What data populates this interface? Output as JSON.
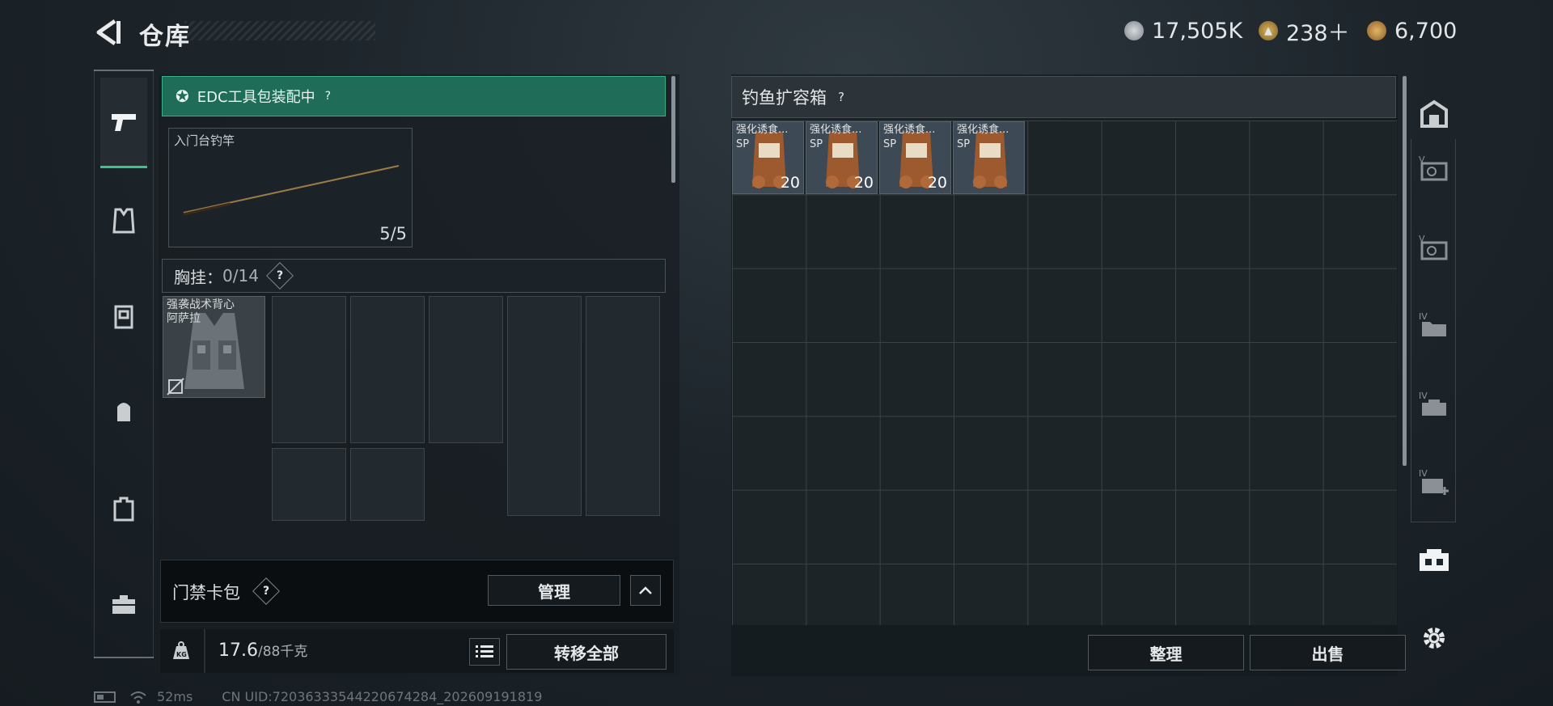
{
  "header": {
    "title": "仓库",
    "currencies": [
      {
        "icon": "silver-coin-icon",
        "value": "17,505K"
      },
      {
        "icon": "triangle-coin-icon",
        "value": "238＋"
      },
      {
        "icon": "gold-coin-icon",
        "value": "6,700"
      }
    ]
  },
  "left_tabs": [
    {
      "icon": "pistol-icon",
      "active": true
    },
    {
      "icon": "armor-icon"
    },
    {
      "icon": "chest-rig-icon"
    },
    {
      "icon": "backpack-icon"
    },
    {
      "icon": "case-icon"
    },
    {
      "icon": "toolbox-icon"
    }
  ],
  "loadout": {
    "edc_banner": "EDC工具包装配中",
    "edc_help": "?",
    "rod_name": "入门台钓竿",
    "rod_count": "5/5",
    "chest_rig_label": "胸挂：",
    "chest_rig_value": "0/14",
    "chest_rig_help": "?",
    "vest_name_line1": "强袭战术背心",
    "vest_name_line2": "阿萨拉",
    "keycard_label": "门禁卡包",
    "keycard_help": "?",
    "manage_label": "管理",
    "weight_value": "17.6",
    "weight_max": "/88千克",
    "transfer_all_label": "转移全部"
  },
  "storage": {
    "title": "钓鱼扩容箱",
    "help": "?",
    "items": [
      {
        "name": "强化诱食...",
        "tag": "SP",
        "count": "20"
      },
      {
        "name": "强化诱食...",
        "tag": "SP",
        "count": "20"
      },
      {
        "name": "强化诱食...",
        "tag": "SP",
        "count": "20"
      },
      {
        "name": "强化诱食...",
        "tag": "SP",
        "count": ""
      }
    ],
    "sort_label": "整理",
    "sell_label": "出售"
  },
  "right_tabs": [
    {
      "icon": "warehouse-icon"
    },
    {
      "icon": "storage-v-icon",
      "roman": "V"
    },
    {
      "icon": "storage-v-icon",
      "roman": "V"
    },
    {
      "icon": "storage-iv-folder-icon",
      "roman": "IV"
    },
    {
      "icon": "storage-iv-tools-icon",
      "roman": "IV"
    },
    {
      "icon": "storage-iv-add-icon",
      "roman": "IV"
    },
    {
      "icon": "fishing-box-icon"
    },
    {
      "icon": "settings-gear-icon"
    }
  ],
  "status_bar": {
    "ping": "52ms",
    "uid": "CN UID:72036333544220674284_202609191819"
  },
  "colors": {
    "accent_green": "#3ec28b",
    "edc_bg": "#1f6d58"
  }
}
